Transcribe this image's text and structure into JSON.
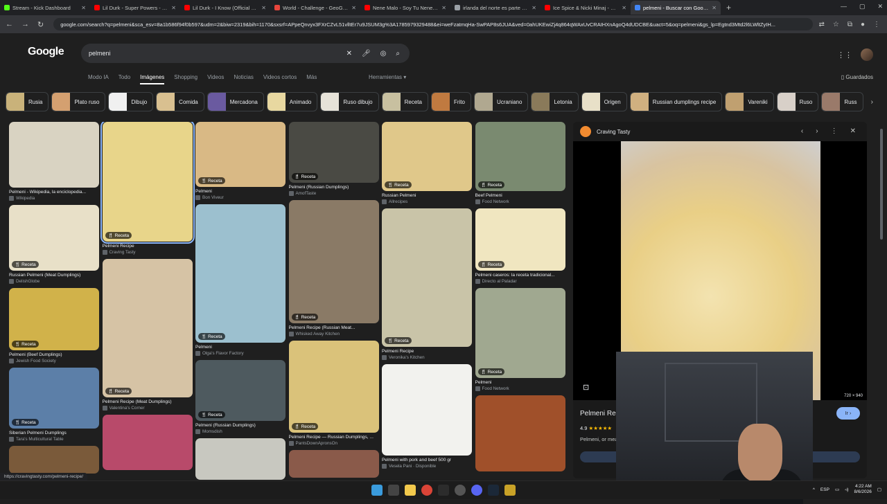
{
  "browser": {
    "tabs": [
      {
        "title": "Stream - Kick Dashboard",
        "color": "#53fc18"
      },
      {
        "title": "Lil Durk - Super Powers - YouTu",
        "color": "#ff0000"
      },
      {
        "title": "Lil Durk - I Know (Official Vide",
        "color": "#ff0000"
      },
      {
        "title": "World - Challenge - GeoGuessr",
        "color": "#e8453c"
      },
      {
        "title": "Nene Malo - Soy Tu Nene Mal",
        "color": "#ff0000"
      },
      {
        "title": "irlanda del norte es parte de la",
        "color": "#9aa0a6"
      },
      {
        "title": "Ice Spice & Nicki Minaj - Prince",
        "color": "#ff0000"
      },
      {
        "title": "pelmeni - Buscar con Google",
        "color": "#4285f4"
      }
    ],
    "new_tab": "+",
    "url": "google.com/search?q=pelmeni&sca_esv=8a1b586f94f0b597&udm=2&biw=2319&bih=1170&sxsrf=APpeQnvyx3FXrCZvL51vlltEr7u9JSUM3g%3A1785979329488&ei=weFzatmqHa-SwPAP8s6JUA&ved=0ahUKEwiZj4q864qWAxUvCRAIHXnAgoQ4dUDCBE&uact=5&oq=pelmeni&gs_lp=Egtnd3Mtd2l6LWltZyIH..."
  },
  "google": {
    "logo": "Google",
    "query": "pelmeni",
    "tabs": [
      "Modo IA",
      "Todo",
      "Imágenes",
      "Shopping",
      "Videos",
      "Noticias",
      "Videos cortos",
      "Más"
    ],
    "tools": "Herramientas",
    "saved": "Guardados",
    "chips": [
      {
        "label": "Rusia",
        "color": "#c9b27a"
      },
      {
        "label": "Plato ruso",
        "color": "#d4a070"
      },
      {
        "label": "Dibujo",
        "color": "#f0f0f0"
      },
      {
        "label": "Comida",
        "color": "#d9c090"
      },
      {
        "label": "Mercadona",
        "color": "#6a5aa0"
      },
      {
        "label": "Animado",
        "color": "#e8d8a0"
      },
      {
        "label": "Ruso dibujo",
        "color": "#e6e2d8"
      },
      {
        "label": "Receta",
        "color": "#c8c0a0"
      },
      {
        "label": "Frito",
        "color": "#c07a40"
      },
      {
        "label": "Ucraniano",
        "color": "#b0a890"
      },
      {
        "label": "Letonia",
        "color": "#8a7a5a"
      },
      {
        "label": "Origen",
        "color": "#e8e0c8"
      },
      {
        "label": "Russian dumplings recipe",
        "color": "#d0b080"
      },
      {
        "label": "Vareniki",
        "color": "#c0a070"
      },
      {
        "label": "Ruso",
        "color": "#d8d0c8"
      },
      {
        "label": "Russ",
        "color": "#9a7a6a"
      }
    ]
  },
  "results": {
    "badge": "Receta",
    "columns": [
      [
        {
          "title": "Pelmeni - Wikipedia, la enciclopedia...",
          "source": "Wikipedia",
          "badge": false,
          "color": "#d9d3c2"
        },
        {
          "title": "Russian Pelmeni (Meat Dumplings)",
          "source": "DelishGlobe",
          "badge": true,
          "color": "#e8e0c8"
        },
        {
          "title": "Pelmeni (Beef Dumplings)",
          "source": "Jewish Food Society",
          "badge": true,
          "color": "#d1b24a"
        },
        {
          "title": "Siberian Pelmeni Dumplings",
          "source": "Tara's Multicultural Table",
          "badge": true,
          "color": "#5c7fa8"
        },
        {
          "title": "",
          "source": "",
          "badge": false,
          "color": "#7a5a3a"
        }
      ],
      [
        {
          "title": "Pelmeni Recipe",
          "source": "Craving Tasty",
          "badge": true,
          "color": "#e8d58a",
          "selected": true
        },
        {
          "title": "Pelmeni Recipe (Meat Dumplings)",
          "source": "Valentina's Corner",
          "badge": true,
          "color": "#d6c3a5"
        },
        {
          "title": "",
          "source": "",
          "badge": false,
          "color": "#b84a6a"
        }
      ],
      [
        {
          "title": "Pelmeni",
          "source": "Bon Viveur",
          "badge": true,
          "color": "#d9b985"
        },
        {
          "title": "Pelmeni",
          "source": "Olga's Flavor Factory",
          "badge": true,
          "color": "#9cc0cf"
        },
        {
          "title": "Pelmeni (Russian Dumplings)",
          "source": "Momsdish",
          "badge": true,
          "color": "#4e5a5f"
        },
        {
          "title": "",
          "source": "",
          "badge": false,
          "color": "#c8c8c0"
        }
      ],
      [
        {
          "title": "Pelmeni (Russian Dumplings)",
          "source": "AmofTaste",
          "badge": true,
          "color": "#4a4a44"
        },
        {
          "title": "Pelmeni Recipe (Russian Meat...",
          "source": "Whisked Away Kitchen",
          "badge": true,
          "color": "#8a7a66"
        },
        {
          "title": "Pelmeni Recipe — Russian Dumplings, ...",
          "source": "PantsDownApronsOn",
          "badge": true,
          "color": "#dac27a"
        },
        {
          "title": "",
          "source": "",
          "badge": false,
          "color": "#8a5a4a"
        }
      ],
      [
        {
          "title": "Russian Pelmeni",
          "source": "Allrecipes",
          "badge": true,
          "color": "#e0c88a"
        },
        {
          "title": "Pelmeni Recipe",
          "source": "Veronika's Kitchen",
          "badge": true,
          "color": "#c9c4a8"
        },
        {
          "title": "Pelmeni with pork and beef 500 gr",
          "source": "Vesela Pani · Disponible",
          "badge": false,
          "color": "#f2f2ee"
        }
      ],
      [
        {
          "title": "Beef Pelmeni",
          "source": "Food Network",
          "badge": true,
          "color": "#7a8a70"
        },
        {
          "title": "Pelmeni caseros: la receta tradicional...",
          "source": "Directo al Paladar",
          "badge": true,
          "color": "#f0e6c0"
        },
        {
          "title": "Pelmeni",
          "source": "Food Network",
          "badge": true,
          "color": "#a0a890"
        },
        {
          "title": "",
          "source": "",
          "badge": false,
          "color": "#a0502a"
        }
      ]
    ]
  },
  "panel": {
    "source": "Craving Tasty",
    "dims": "720 × 940",
    "title": "Pelmeni Rec",
    "rating": "4.9",
    "stars": "★★★★★",
    "desc": "Pelmeni, or mea",
    "go": "Ir"
  },
  "status_url": "https://cravingtasty.com/pelmeni-recipe/",
  "taskbar": {
    "lang": "ESP",
    "time": "4:22 AM",
    "date": "8/6/2026"
  }
}
